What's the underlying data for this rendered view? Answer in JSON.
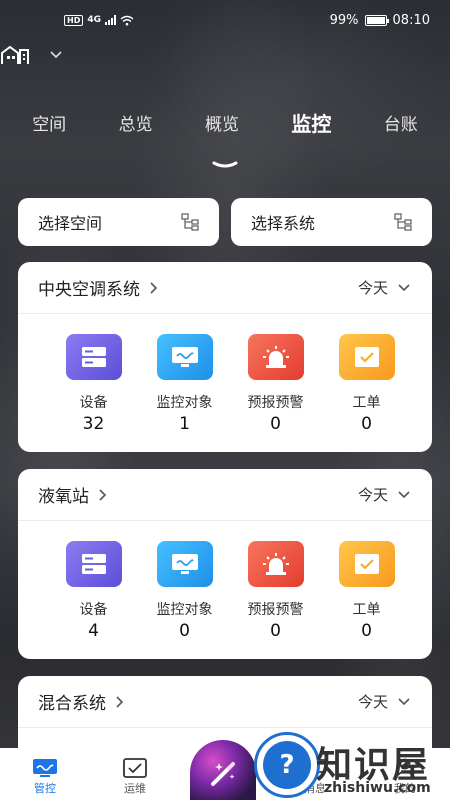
{
  "status_bar": {
    "hd": "HD",
    "network": "4G",
    "battery": "99%",
    "time": "08:10"
  },
  "tabs": [
    {
      "label": "空间"
    },
    {
      "label": "总览"
    },
    {
      "label": "概览"
    },
    {
      "label": "监控",
      "active": true
    },
    {
      "label": "台账"
    }
  ],
  "selectors": {
    "space": "选择空间",
    "system": "选择系统"
  },
  "cards": [
    {
      "title": "中央空调系统",
      "period": "今天",
      "stats": [
        {
          "label": "设备",
          "value": "32"
        },
        {
          "label": "监控对象",
          "value": "1"
        },
        {
          "label": "预报预警",
          "value": "0"
        },
        {
          "label": "工单",
          "value": "0"
        }
      ]
    },
    {
      "title": "液氧站",
      "period": "今天",
      "stats": [
        {
          "label": "设备",
          "value": "4"
        },
        {
          "label": "监控对象",
          "value": "0"
        },
        {
          "label": "预报预警",
          "value": "0"
        },
        {
          "label": "工单",
          "value": "0"
        }
      ]
    },
    {
      "title": "混合系统",
      "period": "今天"
    }
  ],
  "bottom_nav": [
    {
      "label": "管控",
      "icon": "monitor-icon",
      "active": true
    },
    {
      "label": "运维",
      "icon": "checkbox-icon"
    },
    {
      "label": "消息",
      "icon": "message-icon"
    },
    {
      "label": "我的",
      "icon": "user-icon"
    }
  ],
  "watermark": {
    "icon_text": "?",
    "text": "知识屋",
    "url": "zhishiwu.com",
    "registered": "®"
  },
  "colors": {
    "accent": "#1c76e6",
    "device_icon": "#6a5ce0",
    "monitor_icon": "#2b9ff0",
    "alarm_icon": "#ea4b38",
    "order_icon": "#f9ac2d"
  }
}
